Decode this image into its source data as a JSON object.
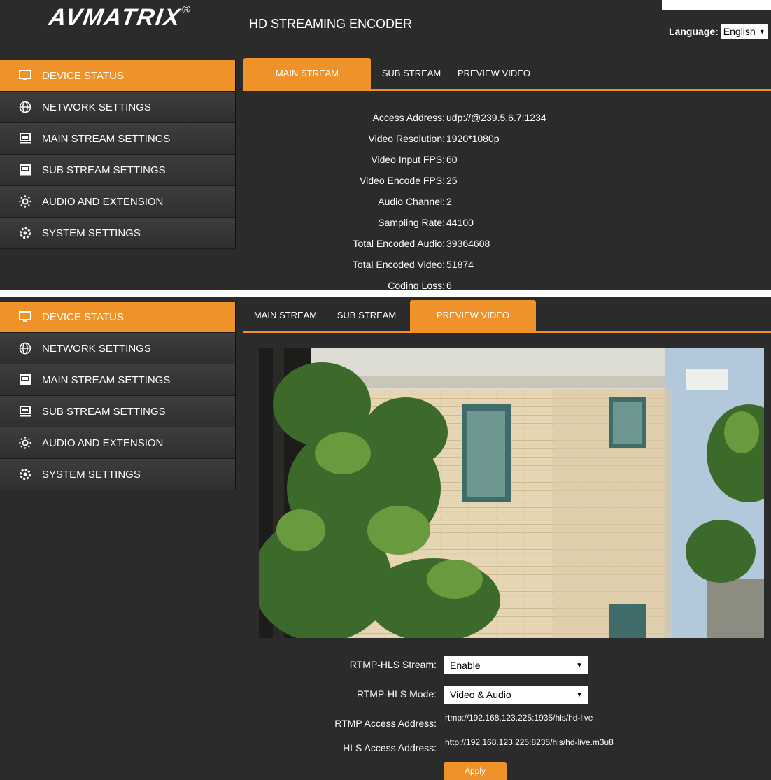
{
  "header": {
    "logo_text": "AVMATRIX",
    "logo_mark": "®",
    "app_title": "HD STREAMING ENCODER",
    "language_label": "Language:",
    "language_value": "English"
  },
  "sidebar": {
    "items": [
      {
        "label": "DEVICE STATUS",
        "icon": "monitor-icon"
      },
      {
        "label": "NETWORK SETTINGS",
        "icon": "globe-icon"
      },
      {
        "label": "MAIN STREAM SETTINGS",
        "icon": "stream-icon"
      },
      {
        "label": "SUB STREAM SETTINGS",
        "icon": "stream-icon"
      },
      {
        "label": "AUDIO AND EXTENSION",
        "icon": "audio-icon"
      },
      {
        "label": "SYSTEM SETTINGS",
        "icon": "gear-icon"
      }
    ],
    "active_index": 0
  },
  "tabs": [
    "MAIN STREAM",
    "SUB STREAM",
    "PREVIEW VIDEO"
  ],
  "status": [
    {
      "label": "Access Address:",
      "value": "udp://@239.5.6.7:1234"
    },
    {
      "label": "Video Resolution:",
      "value": "1920*1080p"
    },
    {
      "label": "Video Input FPS:",
      "value": "60"
    },
    {
      "label": "Video Encode FPS:",
      "value": "25"
    },
    {
      "label": "Audio Channel:",
      "value": "2"
    },
    {
      "label": "Sampling Rate:",
      "value": "44100"
    },
    {
      "label": "Total Encoded Audio:",
      "value": "39364608"
    },
    {
      "label": "Total Encoded Video:",
      "value": "51874"
    },
    {
      "label": "Coding Loss:",
      "value": "6"
    }
  ],
  "preview": {
    "rtmp_hls_stream_label": "RTMP-HLS Stream:",
    "rtmp_hls_stream_value": "Enable",
    "rtmp_hls_mode_label": "RTMP-HLS Mode:",
    "rtmp_hls_mode_value": "Video & Audio",
    "rtmp_address_label": "RTMP Access Address:",
    "rtmp_address_value": "rtmp://192.168.123.225:1935/hls/hd-live",
    "hls_address_label": "HLS Access Address:",
    "hls_address_value": "http://192.168.123.225:8235/hls/hd-live.m3u8",
    "apply_label": "Apply"
  },
  "colors": {
    "accent": "#f0922a",
    "background": "#2b2b2b",
    "sidebar_item": "#363636"
  }
}
